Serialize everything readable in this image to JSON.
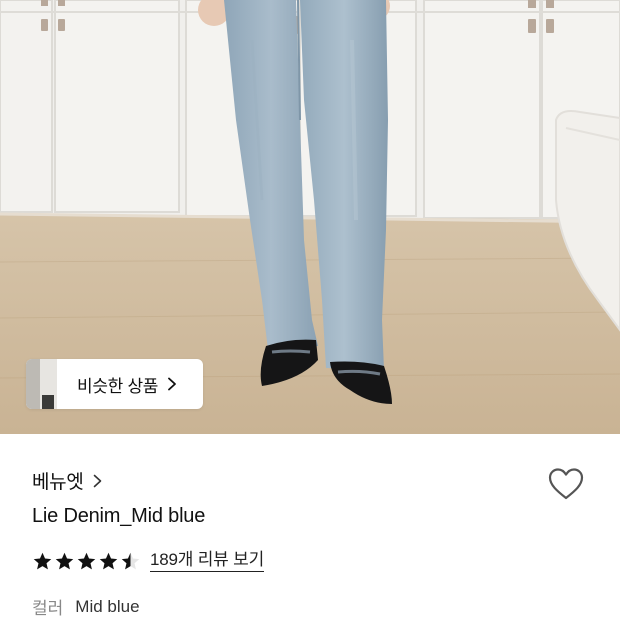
{
  "similar_products": {
    "label": "비슷한 상품"
  },
  "product": {
    "brand": "베뉴엣",
    "name": "Lie Denim_Mid blue",
    "rating": 4.5,
    "review_link": "189개 리뷰 보기",
    "option_label": "컬러",
    "option_value": "Mid blue"
  },
  "icons": {
    "wishlist": "heart-outline-icon",
    "brand_chevron": "chevron-right-icon",
    "similar_chevron": "chevron-right-icon",
    "star": "star-icon"
  },
  "colors": {
    "text_primary": "#111111",
    "text_muted": "#888888",
    "star": "#111111",
    "heart_stroke": "#555555"
  }
}
